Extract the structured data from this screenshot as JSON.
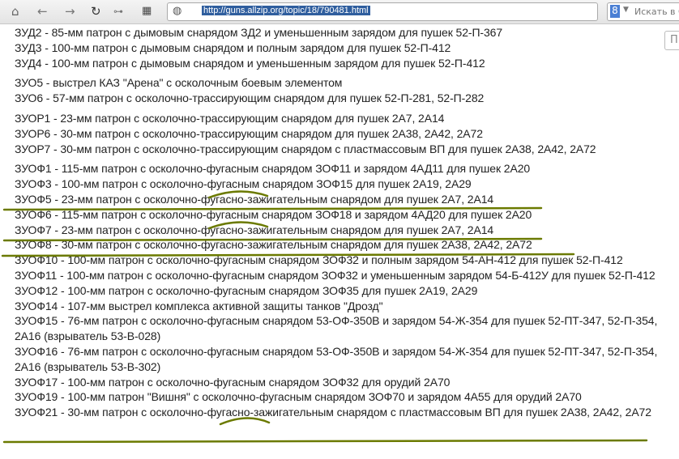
{
  "browser": {
    "url": "http://guns.allzip.org/topic/18/790481.html",
    "search_placeholder": "Искать в G",
    "side_input": "П"
  },
  "groups": [
    [
      "ЗУД2 - 85-мм патрон с дымовым снарядом ЗД2 и уменьшенным зарядом для пушек 52-П-367",
      "ЗУД3 - 100-мм патрон с дымовым снарядом и полным зарядом для пушек 52-П-412",
      "ЗУД4 - 100-мм патрон с дымовым снарядом и уменьшенным зарядом для пушек 52-П-412"
    ],
    [
      "ЗУО5 - выстрел КАЗ \"Арена\" с осколочным боевым элементом",
      "ЗУО6 - 57-мм патрон с осколочно-трассирующим снарядом для пушек 52-П-281, 52-П-282"
    ],
    [
      "ЗУОР1 - 23-мм патрон с осколочно-трассирующим снарядом для пушек 2А7, 2А14",
      "ЗУОР6 - 30-мм патрон с осколочно-трассирующим снарядом для пушек 2А38, 2А42, 2А72",
      "ЗУОР7 - 30-мм патрон с осколочно-трассирующим снарядом с пластмассовым ВП для пушек 2А38, 2А42, 2А72"
    ],
    [
      "ЗУОФ1 - 115-мм патрон с осколочно-фугасным снарядом ЗОФ11 и зарядом 4АД11 для пушек 2А20",
      "ЗУОФ3 - 100-мм патрон с осколочно-фугасным снарядом ЗОФ15 для пушек 2А19, 2А29",
      "ЗУОФ5 - 23-мм патрон с осколочно-фугасно-зажигательным снарядом для пушек 2А7, 2А14",
      "ЗУОФ6 - 115-мм патрон с осколочно-фугасным снарядом ЗОФ18 и зарядом 4АД20 для пушек 2А20",
      "ЗУОФ7 - 23-мм патрон с осколочно-фугасно-зажигательным снарядом для пушек 2А7, 2А14",
      "ЗУОФ8 - 30-мм патрон с осколочно-фугасно-зажигательным снарядом для пушек 2А38, 2А42, 2А72",
      "ЗУОФ10 - 100-мм патрон с осколочно-фугасным снарядом ЗОФ32 и полным зарядом 54-АН-412 для пушек 52-П-412",
      "ЗУОФ11 - 100-мм патрон с осколочно-фугасным снарядом ЗОФ32 и уменьшенным зарядом 54-Б-412У для пушек 52-П-412",
      "ЗУОФ12 - 100-мм патрон с осколочно-фугасным снарядом ЗОФ35 для пушек 2А19, 2А29",
      "ЗУОФ14 - 107-мм выстрел комплекса активной защиты танков \"Дрозд\"",
      "ЗУОФ15 - 76-мм патрон с осколочно-фугасным снарядом 53-ОФ-350В и зарядом 54-Ж-354 для пушек 52-ПТ-347, 52-П-354, 2А16 (взрыватель 53-В-028)",
      "ЗУОФ16 - 76-мм патрон с осколочно-фугасным снарядом 53-ОФ-350В и зарядом 54-Ж-354 для пушек 52-ПТ-347, 52-П-354, 2А16 (взрыватель 53-В-302)",
      "ЗУОФ17 - 100-мм патрон с осколочно-фугасным снарядом ЗОФ32 для орудий 2А70",
      "ЗУОФ19 - 100-мм патрон \"Вишня\" с осколочно-фугасным снарядом ЗОФ70 и зарядом 4А55 для орудий 2А70",
      "ЗУОФ21 - 30-мм патрон с осколочно-фугасно-зажигательным снарядом с пластмассовым ВП для пушек 2А38, 2А42, 2А72"
    ]
  ],
  "colors": {
    "marker": "#6b7a00"
  }
}
